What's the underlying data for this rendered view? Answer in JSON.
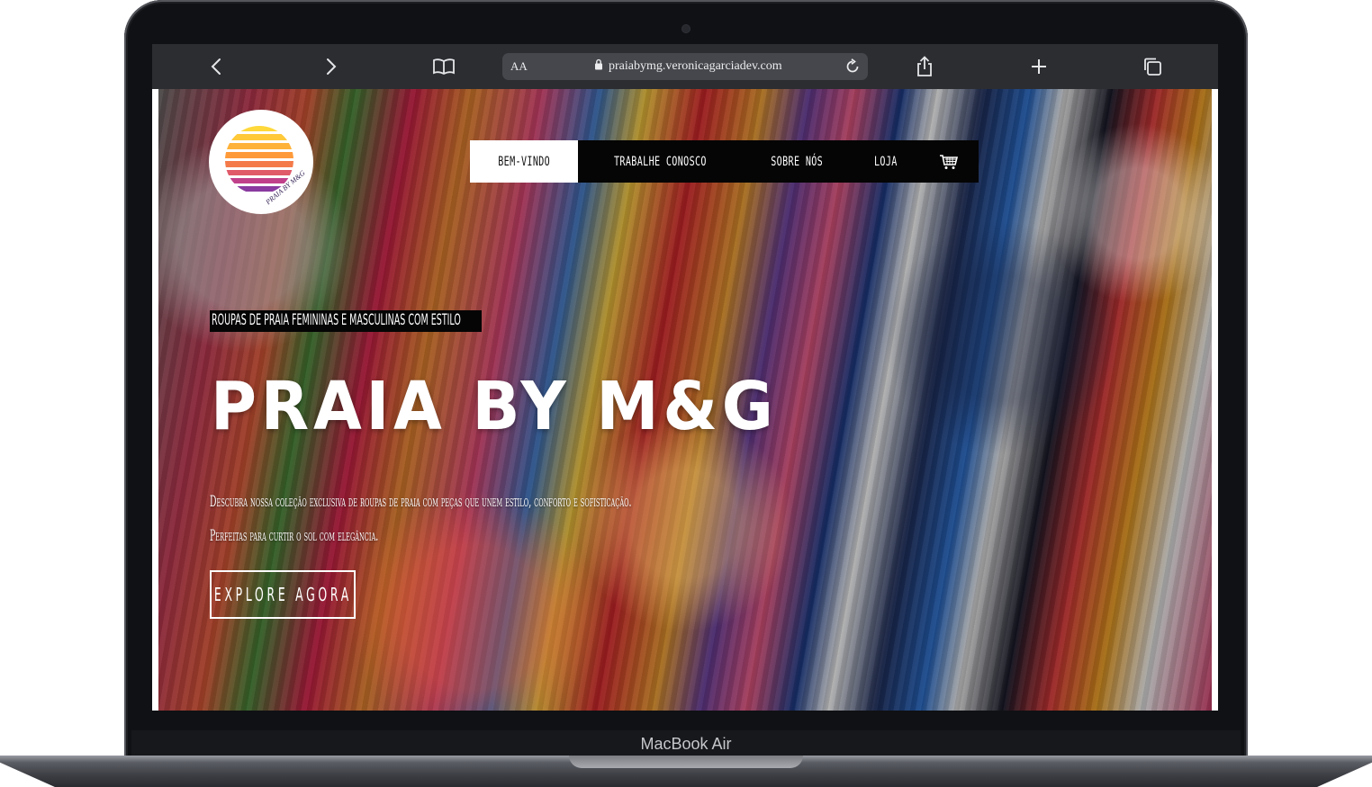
{
  "device": {
    "label": "MacBook Air"
  },
  "browser": {
    "text_size_label": "AA",
    "url": "praiabymg.veronicagarciadev.com",
    "icons": {
      "back": "chevron-left-icon",
      "forward": "chevron-right-icon",
      "bookmarks": "book-icon",
      "lock": "lock-icon",
      "reload": "reload-icon",
      "share": "share-icon",
      "new_tab": "plus-icon",
      "tabs": "tabs-icon"
    }
  },
  "site": {
    "logo_text": "PRAIA BY M&G",
    "nav": [
      {
        "label": "Bem-vindo",
        "active": true
      },
      {
        "label": "Trabalhe conosco",
        "active": false
      },
      {
        "label": "Sobre nós",
        "active": false
      },
      {
        "label": "Loja",
        "active": false
      }
    ],
    "cart_icon": "cart-icon",
    "hero": {
      "tagline": "Roupas de praia femininas e masculinas com estilo",
      "title": "PRAIA BY M&G",
      "description_line1": "Descubra nossa coleção exclusiva de roupas de praia com peças que unem estilo, conforto e sofisticação.",
      "description_line2": "Perfeitas para curtir o sol com elegância.",
      "cta_label": "Explore agora"
    }
  },
  "colors": {
    "frame": "#101114",
    "toolbar": "#2b2d31",
    "urlbar": "#45474c",
    "nav_bg": "#050505",
    "nav_active_bg": "#ffffff",
    "text_light": "#ffffff"
  }
}
